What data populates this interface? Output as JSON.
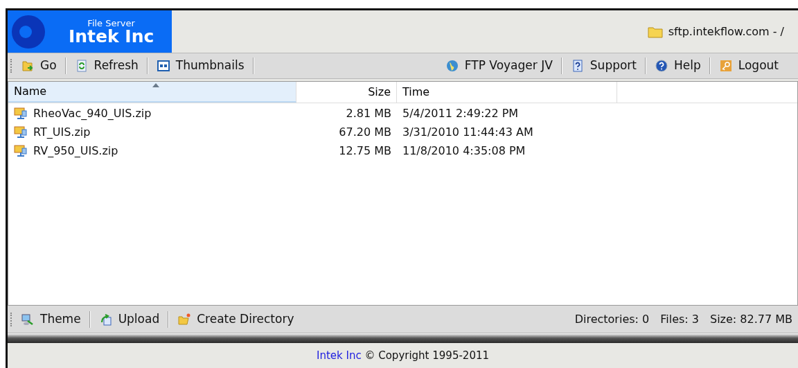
{
  "header": {
    "logo_subtitle": "File Server",
    "logo_title": "Intek Inc",
    "location": "sftp.intekflow.com - /"
  },
  "toolbar": {
    "left": [
      {
        "kind": "go",
        "label": "Go"
      },
      {
        "kind": "refresh",
        "label": "Refresh"
      },
      {
        "kind": "thumbnails",
        "label": "Thumbnails"
      }
    ],
    "right": [
      {
        "kind": "globe",
        "label": "FTP Voyager JV"
      },
      {
        "kind": "support",
        "label": "Support"
      },
      {
        "kind": "help",
        "label": "Help"
      },
      {
        "kind": "logout",
        "label": "Logout"
      }
    ]
  },
  "table": {
    "columns": [
      {
        "label": "Name",
        "sorted": true
      },
      {
        "label": "Size",
        "sorted": false
      },
      {
        "label": "Time",
        "sorted": false
      }
    ],
    "rows": [
      {
        "name": "RheoVac_940_UIS.zip",
        "size": "2.81 MB",
        "time": "5/4/2011 2:49:22 PM"
      },
      {
        "name": "RT_UIS.zip",
        "size": "67.20 MB",
        "time": "3/31/2010 11:44:43 AM"
      },
      {
        "name": "RV_950_UIS.zip",
        "size": "12.75 MB",
        "time": "11/8/2010 4:35:08 PM"
      }
    ]
  },
  "bottom_toolbar": [
    {
      "kind": "theme",
      "label": "Theme"
    },
    {
      "kind": "upload",
      "label": "Upload"
    },
    {
      "kind": "create_directory",
      "label": "Create Directory"
    }
  ],
  "status_bar": [
    "Directories: 0",
    "Files: 3",
    "Size: 82.77 MB"
  ],
  "footer": {
    "link": "Intek Inc",
    "text": "© Copyright 1995-2011"
  }
}
